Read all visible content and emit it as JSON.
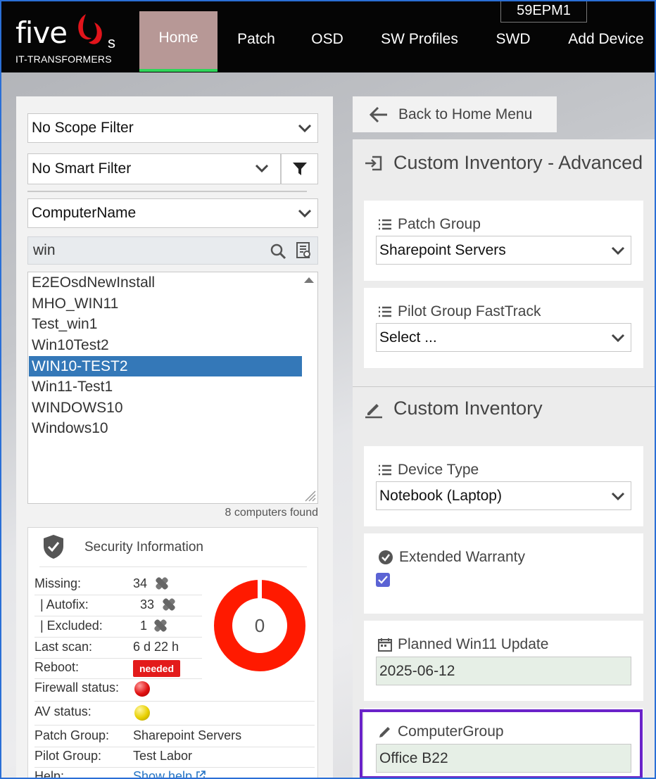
{
  "header": {
    "logo_text": "five",
    "logo_suffix": "s",
    "logo_subtitle": "IT-TRANSFORMERS",
    "device_name": "59EPM1",
    "nav": [
      {
        "label": "Home",
        "active": true
      },
      {
        "label": "Patch",
        "active": false
      },
      {
        "label": "OSD",
        "active": false
      },
      {
        "label": "SW Profiles",
        "active": false
      },
      {
        "label": "SWD",
        "active": false
      },
      {
        "label": "Add Device",
        "active": false
      }
    ],
    "colors": {
      "bar": "#050505",
      "active_tab": "#b79896",
      "active_underline": "#2fd55a"
    }
  },
  "filters": {
    "scope": "No Scope Filter",
    "smart": "No Smart Filter",
    "field": "ComputerName",
    "search_value": "win"
  },
  "computers": {
    "items": [
      "E2EOsdNewInstall",
      "MHO_WIN11",
      "Test_win1",
      "Win10Test2",
      "WIN10-TEST2",
      "Win11-Test1",
      "WINDOWS10",
      "Windows10"
    ],
    "selected": "WIN10-TEST2",
    "count_text": "8 computers found"
  },
  "security": {
    "title": "Security Information",
    "missing_label": "Missing:",
    "missing_value": "34",
    "autofix_label": "| Autofix:",
    "autofix_value": "33",
    "excluded_label": "| Excluded:",
    "excluded_value": "1",
    "last_scan_label": "Last scan:",
    "last_scan_value": "6 d 22 h",
    "reboot_label": "Reboot:",
    "reboot_value": "needed",
    "firewall_label": "Firewall status:",
    "firewall_color": "#e01010",
    "av_label": "AV status:",
    "av_color": "#e8d000",
    "patch_group_label": "Patch Group:",
    "patch_group_value": "Sharepoint Servers",
    "pilot_group_label": "Pilot Group:",
    "pilot_group_value": "Test Labor",
    "help_label": "Help:",
    "help_value": "Show help",
    "donut_value": "0",
    "donut_color": "#ff1a00"
  },
  "right": {
    "back_label": "Back to Home Menu",
    "advanced_title": "Custom Inventory - Advanced",
    "patch_group": {
      "label": "Patch Group",
      "value": "Sharepoint Servers"
    },
    "pilot_group": {
      "label": "Pilot Group FastTrack",
      "value": "Select ..."
    },
    "custom_title": "Custom Inventory",
    "device_type": {
      "label": "Device Type",
      "value": "Notebook (Laptop)"
    },
    "extended_warranty": {
      "label": "Extended Warranty",
      "checked": true
    },
    "planned_update": {
      "label": "Planned Win11 Update",
      "value": "2025-06-12"
    },
    "computer_group": {
      "label": "ComputerGroup",
      "value": "Office B22"
    },
    "highlight_color": "#6a22c9"
  }
}
